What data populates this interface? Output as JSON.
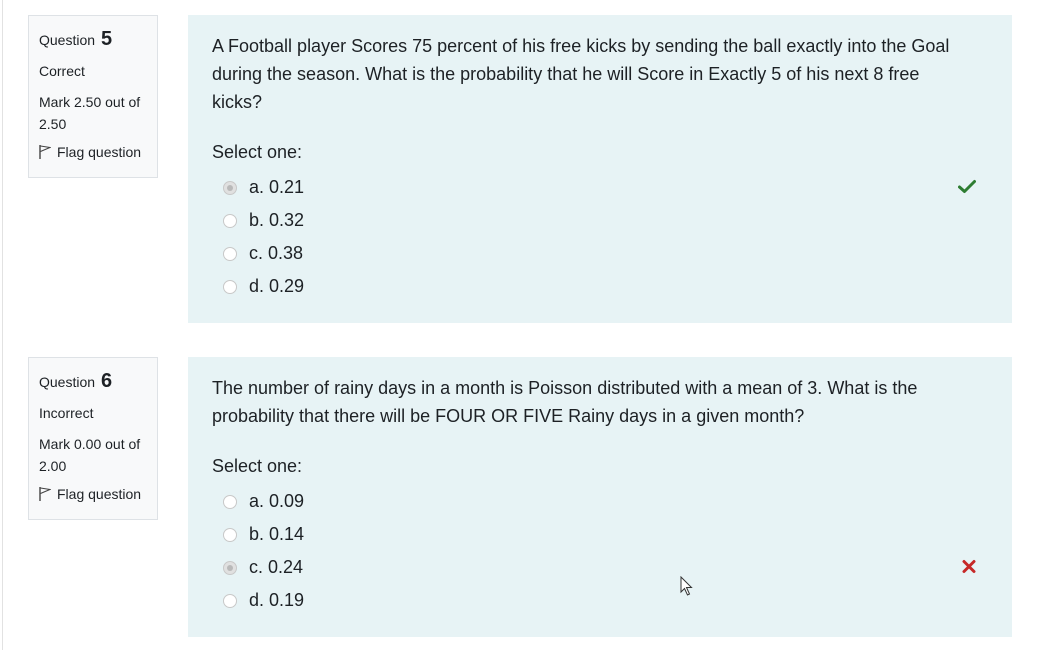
{
  "questions": [
    {
      "label": "Question",
      "number": "5",
      "state": "Correct",
      "grade": "Mark 2.50 out of 2.50",
      "flag": "Flag question",
      "text": "A Football player Scores 75 percent of his free kicks by sending the ball exactly into the Goal during the season. What is the probability that he will Score in Exactly 5 of his next 8 free kicks?",
      "prompt": "Select one:",
      "options": [
        "a. 0.21",
        "b. 0.32",
        "c. 0.38",
        "d. 0.29"
      ],
      "selected_index": 0,
      "result": "correct"
    },
    {
      "label": "Question",
      "number": "6",
      "state": "Incorrect",
      "grade": "Mark 0.00 out of 2.00",
      "flag": "Flag question",
      "text": "The number of rainy days in a month is Poisson distributed with a mean of 3. What is the probability that there will be FOUR OR FIVE Rainy days in a given month?",
      "prompt": "Select one:",
      "options": [
        "a. 0.09",
        "b. 0.14",
        "c. 0.24",
        "d. 0.19"
      ],
      "selected_index": 2,
      "result": "incorrect"
    }
  ],
  "colors": {
    "correct": "#2e7d32",
    "incorrect": "#c62828",
    "content_bg": "#e7f3f5",
    "info_bg": "#f8f9fa"
  },
  "icons": {
    "correct": "check-icon",
    "incorrect": "cross-icon",
    "flag": "flag-icon"
  }
}
